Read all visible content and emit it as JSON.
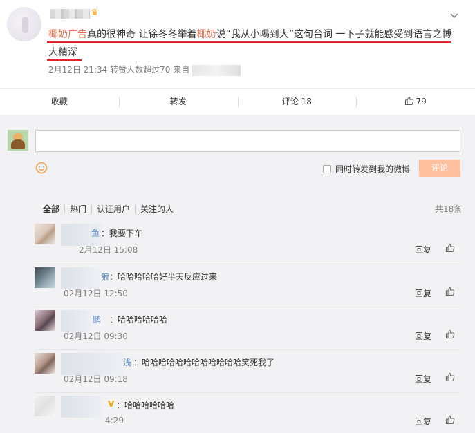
{
  "post": {
    "text_segments": [
      {
        "text": "椰奶广告",
        "highlight": true
      },
      {
        "text": "真的很神奇 让徐冬冬举着",
        "highlight": false
      },
      {
        "text": "椰奶",
        "highlight": true
      },
      {
        "text": "说“我从小喝到大”这句台词 一下子就能感受到语言之博大精深",
        "highlight": false
      }
    ],
    "meta": "2月12日 21:34 转赞人数超过70 来自"
  },
  "actions": {
    "favorite": "收藏",
    "repost": "转发",
    "comment": "评论 18",
    "like": "79"
  },
  "composer": {
    "sync_label": "同时转发到我的微博",
    "submit_label": "评论"
  },
  "filters": {
    "items": [
      "全部",
      "热门",
      "认证用户",
      "关注的人"
    ],
    "total": "共18条"
  },
  "comments": [
    {
      "nick": "鱼",
      "text": "：我要下车",
      "time": "2月12日 15:08",
      "reply": "回复"
    },
    {
      "nick": "狼",
      "text": "：哈哈哈哈哈好半天反应过来",
      "time": "02月12日 12:50",
      "reply": "回复"
    },
    {
      "nick": "鹏",
      "text": "：哈哈哈哈哈哈",
      "time": "02月12日 09:30",
      "reply": "回复"
    },
    {
      "nick": "浅",
      "text": "：哈哈哈哈哈哈哈哈哈哈哈哈笑死我了",
      "time": "02月12日 09:18",
      "reply": "回复"
    },
    {
      "nick": "V",
      "text": "：哈哈哈哈哈哈",
      "time": "4:29",
      "reply": "回复"
    }
  ],
  "colors": {
    "accent": "#eb7350",
    "underline": "#e1262b",
    "submit": "#ffc09f",
    "link": "#5a8bc2"
  }
}
